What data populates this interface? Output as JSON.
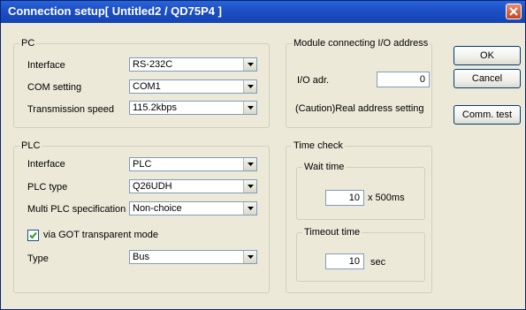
{
  "window": {
    "title": "Connection setup[ Untitled2 / QD75P4 ]"
  },
  "pc": {
    "legend": "PC",
    "interface_label": "Interface",
    "interface_value": "RS-232C",
    "com_label": "COM setting",
    "com_value": "COM1",
    "speed_label": "Transmission speed",
    "speed_value": "115.2kbps"
  },
  "plc": {
    "legend": "PLC",
    "interface_label": "Interface",
    "interface_value": "PLC",
    "type_label": "PLC type",
    "type_value": "Q26UDH",
    "multi_label": "Multi PLC specification",
    "multi_value": "Non-choice",
    "got_label": "via GOT transparent mode",
    "got_checked": true,
    "conn_type_label": "Type",
    "conn_type_value": "Bus"
  },
  "module": {
    "legend": "Module connecting I/O address",
    "io_label": "I/O adr.",
    "io_value": "0",
    "caution": "(Caution)Real address setting"
  },
  "time_check": {
    "legend": "Time check",
    "wait_legend": "Wait time",
    "wait_value": "10",
    "wait_unit": "x 500ms",
    "timeout_legend": "Timeout time",
    "timeout_value": "10",
    "timeout_unit": "sec"
  },
  "buttons": {
    "ok": "OK",
    "cancel": "Cancel",
    "comm_test": "Comm. test"
  }
}
